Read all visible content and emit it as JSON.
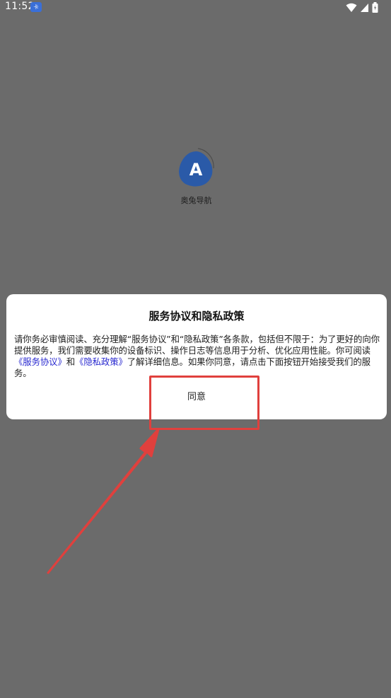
{
  "status_bar": {
    "time": "11:52",
    "notification_badge": "卡",
    "icons": [
      "wifi-icon",
      "signal-icon",
      "battery-icon"
    ]
  },
  "app": {
    "name": "奥兔导航",
    "icon_letter": "A",
    "icon_color": "#2a5aa8"
  },
  "dialog": {
    "title": "服务协议和隐私政策",
    "body_part1": "请你务必审慎阅读、充分理解“服务协议”和“隐私政策”各条款，包括但不限于：为了更好的向你提供服务，我们需要收集你的设备标识、操作日志等信息用于分析、优化应用性能。你可阅读",
    "link_service": "《服务协议》",
    "body_and": "和",
    "link_privacy": "《隐私政策》",
    "body_part2": "了解详细信息。如果你同意，请点击下面按钮开始接受我们的服务。",
    "agree_label": "同意"
  },
  "colors": {
    "overlay_bg": "#6b6b6b",
    "link": "#2a2ad0",
    "annotation": "#e0403d"
  }
}
